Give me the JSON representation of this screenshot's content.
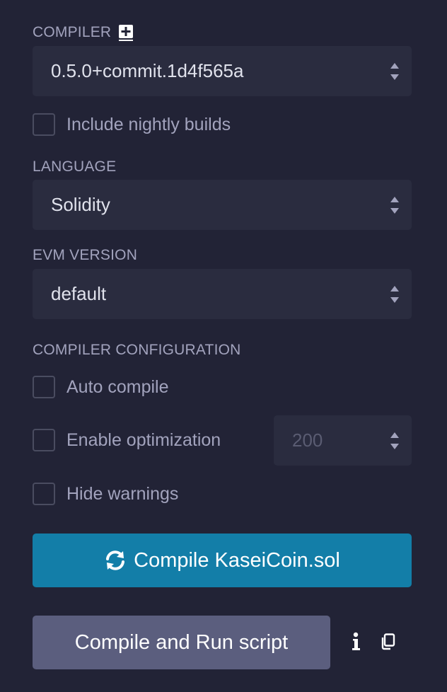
{
  "compiler": {
    "label": "COMPILER",
    "add_icon": "plus-square-icon",
    "version": "0.5.0+commit.1d4f565a"
  },
  "nightly": {
    "label": "Include nightly builds",
    "checked": false
  },
  "language": {
    "label": "LANGUAGE",
    "value": "Solidity"
  },
  "evm": {
    "label": "EVM VERSION",
    "value": "default"
  },
  "config": {
    "label": "COMPILER CONFIGURATION",
    "auto_compile": {
      "label": "Auto compile",
      "checked": false
    },
    "optimization": {
      "label": "Enable optimization",
      "checked": false,
      "runs": "200"
    },
    "hide_warnings": {
      "label": "Hide warnings",
      "checked": false
    }
  },
  "buttons": {
    "compile_label": "Compile KaseiCoin.sol",
    "compile_icon": "refresh-icon",
    "run_label": "Compile and Run script",
    "info_icon": "info-icon",
    "copy_icon": "copy-icon"
  },
  "colors": {
    "background": "#222336",
    "field": "#2a2c3f",
    "compile_button": "#137ea8",
    "run_button": "#5b5e7e"
  }
}
